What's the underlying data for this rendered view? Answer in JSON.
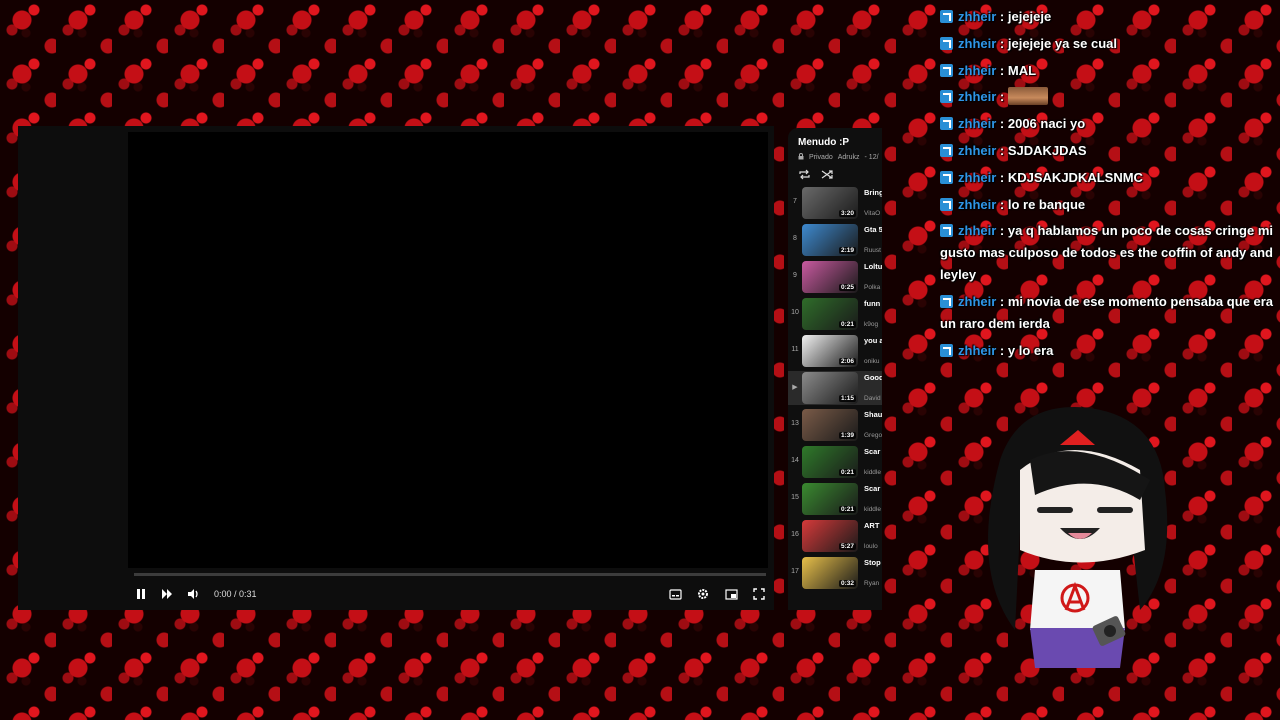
{
  "player": {
    "time": "0:00 / 0:31",
    "icons": [
      "pause-icon",
      "next-icon",
      "volume-icon",
      "subtitles-icon",
      "settings-icon",
      "miniplayer-icon",
      "fullscreen-icon"
    ]
  },
  "playlist": {
    "title": "Menudo :P",
    "privacy": "Privado",
    "owner": "Adrukz",
    "count": "- 12/",
    "items": [
      {
        "index": "7",
        "title": "Bring Brow",
        "channel": "VitaO",
        "duration": "3:20",
        "color": "#6a6a6a"
      },
      {
        "index": "8",
        "title": "Gta 5",
        "channel": "Ruust",
        "duration": "2:19",
        "color": "#3e8ad0"
      },
      {
        "index": "9",
        "title": "Loltu",
        "channel": "Polka",
        "duration": "0:25",
        "color": "#c95aa0"
      },
      {
        "index": "10",
        "title": "funn mob",
        "channel": "k9og",
        "duration": "0:21",
        "color": "#2f6d2a"
      },
      {
        "index": "11",
        "title": "you a",
        "channel": "oniku",
        "duration": "2:06",
        "color": "#f2f2f2"
      },
      {
        "index": "▶",
        "title": "Good",
        "channel": "David",
        "duration": "1:15",
        "color": "#8b8b8b"
      },
      {
        "index": "13",
        "title": "Shau",
        "channel": "Grego",
        "duration": "1:39",
        "color": "#7a5b48"
      },
      {
        "index": "14",
        "title": "Scar",
        "channel": "kiddle",
        "duration": "0:21",
        "color": "#2f7a2a"
      },
      {
        "index": "15",
        "title": "Scar",
        "channel": "kiddle",
        "duration": "0:21",
        "color": "#3a8a30"
      },
      {
        "index": "16",
        "title": "ART NAVI",
        "channel": "loulo",
        "duration": "5:27",
        "color": "#d63a3a"
      },
      {
        "index": "17",
        "title": "Stop",
        "channel": "Ryan",
        "duration": "0:32",
        "color": "#e8c04a"
      }
    ]
  },
  "chat": [
    {
      "user": "zhheir",
      "text": "jejejeje"
    },
    {
      "user": "zhheir",
      "text": "jejejeje ya se cual"
    },
    {
      "user": "zhheir",
      "text": "MAL"
    },
    {
      "user": "zhheir",
      "text": "",
      "emote": "cat-emote"
    },
    {
      "user": "zhheir",
      "text": "2006 naci yo"
    },
    {
      "user": "zhheir",
      "text": "SJDAKJDAS"
    },
    {
      "user": "zhheir",
      "text": "KDJSAKJDKALSNMC"
    },
    {
      "user": "zhheir",
      "text": "lo re banque"
    },
    {
      "user": "zhheir",
      "text": "ya q hablamos un poco de cosas cringe mi gusto mas culposo de todos es the coffin of andy and leyley"
    },
    {
      "user": "zhheir",
      "text": "mi novia de ese momento pensaba que era un raro dem ierda"
    },
    {
      "user": "zhheir",
      "text": "y lo era"
    }
  ],
  "colors": {
    "username": "#2f95e6",
    "badge": "#2a8fd6",
    "background": "#c40f16"
  }
}
